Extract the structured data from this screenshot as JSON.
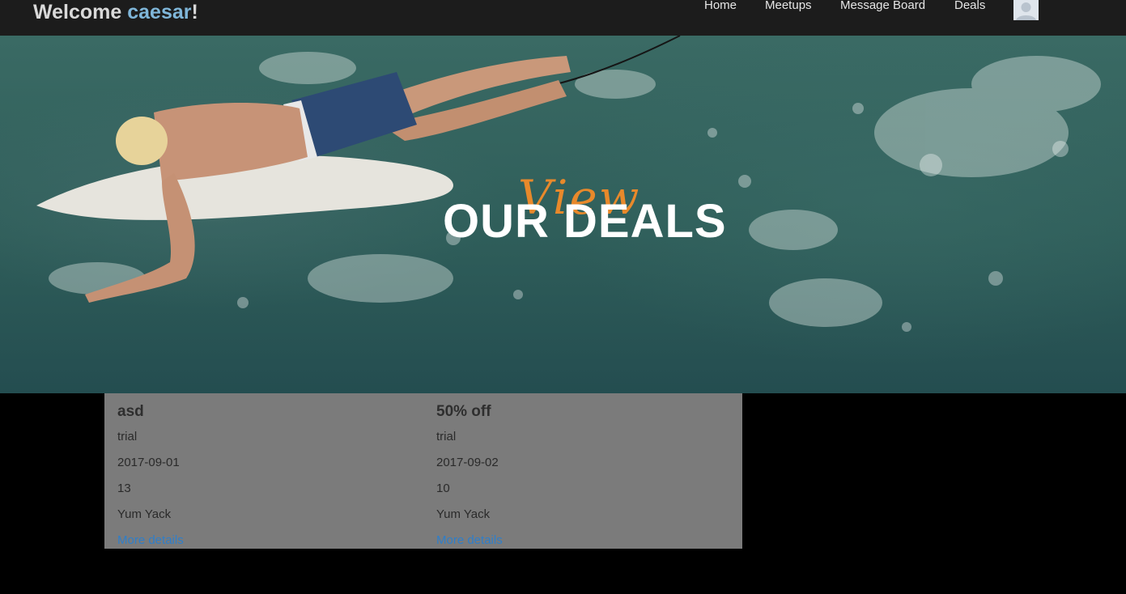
{
  "navbar": {
    "welcome_prefix": "Welcome ",
    "username": "caesar",
    "welcome_suffix": "!",
    "links": [
      "Home",
      "Meetups",
      "Message Board",
      "Deals"
    ]
  },
  "hero": {
    "script_word": "View",
    "title": "OUR DEALS"
  },
  "deals": [
    {
      "title": "asd",
      "description": "trial",
      "date": "2017-09-01",
      "count": "13",
      "business": "Yum Yack",
      "link": "More details"
    },
    {
      "title": "50% off",
      "description": "trial",
      "date": "2017-09-02",
      "count": "10",
      "business": "Yum Yack",
      "link": "More details"
    }
  ],
  "colors": {
    "navbar_bg": "#1c1c1c",
    "username_accent": "#7fb6d9",
    "script_accent": "#e8892b",
    "link": "#2f7ec9",
    "panel_bg": "#7b7b7b"
  }
}
